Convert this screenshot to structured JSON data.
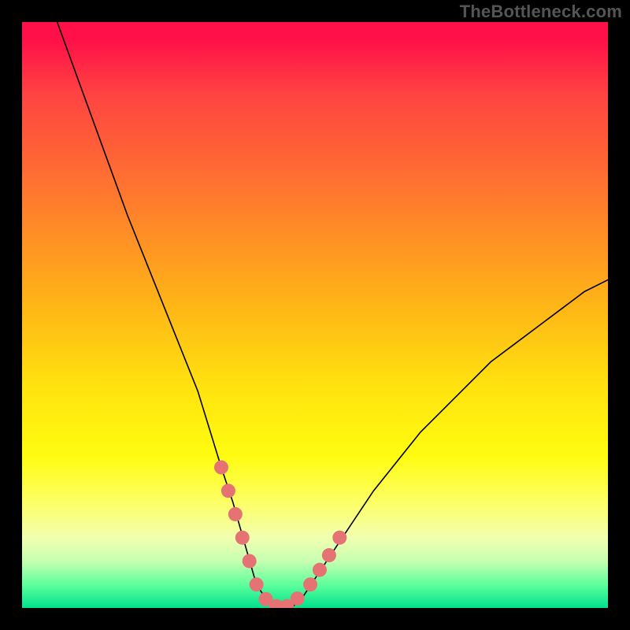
{
  "watermark": "TheBottleneck.com",
  "colors": {
    "frame": "#000000",
    "curve_stroke": "#000000",
    "marker_fill": "#e57373",
    "marker_stroke": "#d86060"
  },
  "chart_data": {
    "type": "line",
    "title": "",
    "xlabel": "",
    "ylabel": "",
    "xlim": [
      0,
      100
    ],
    "ylim": [
      0,
      100
    ],
    "grid": false,
    "legend": false,
    "series": [
      {
        "name": "bottleneck_curve",
        "x": [
          6,
          10,
          14,
          18,
          22,
          26,
          30,
          34,
          36,
          38,
          40,
          42,
          44,
          46,
          48,
          52,
          56,
          60,
          64,
          68,
          72,
          76,
          80,
          84,
          88,
          92,
          96,
          100
        ],
        "y": [
          100,
          89,
          78,
          67,
          57,
          47,
          37,
          24,
          18,
          11,
          4,
          1,
          0,
          0,
          2,
          8,
          14,
          20,
          25,
          30,
          34,
          38,
          42,
          45,
          48,
          51,
          54,
          56
        ]
      }
    ],
    "markers": [
      {
        "x": 34.0,
        "y": 24
      },
      {
        "x": 35.2,
        "y": 20
      },
      {
        "x": 36.4,
        "y": 16
      },
      {
        "x": 37.6,
        "y": 12
      },
      {
        "x": 38.8,
        "y": 8
      },
      {
        "x": 40.0,
        "y": 4
      },
      {
        "x": 41.6,
        "y": 1.5
      },
      {
        "x": 43.4,
        "y": 0.3
      },
      {
        "x": 45.2,
        "y": 0.3
      },
      {
        "x": 47.0,
        "y": 1.6
      },
      {
        "x": 49.2,
        "y": 4
      },
      {
        "x": 50.8,
        "y": 6.5
      },
      {
        "x": 52.4,
        "y": 9
      },
      {
        "x": 54.2,
        "y": 12
      }
    ]
  }
}
